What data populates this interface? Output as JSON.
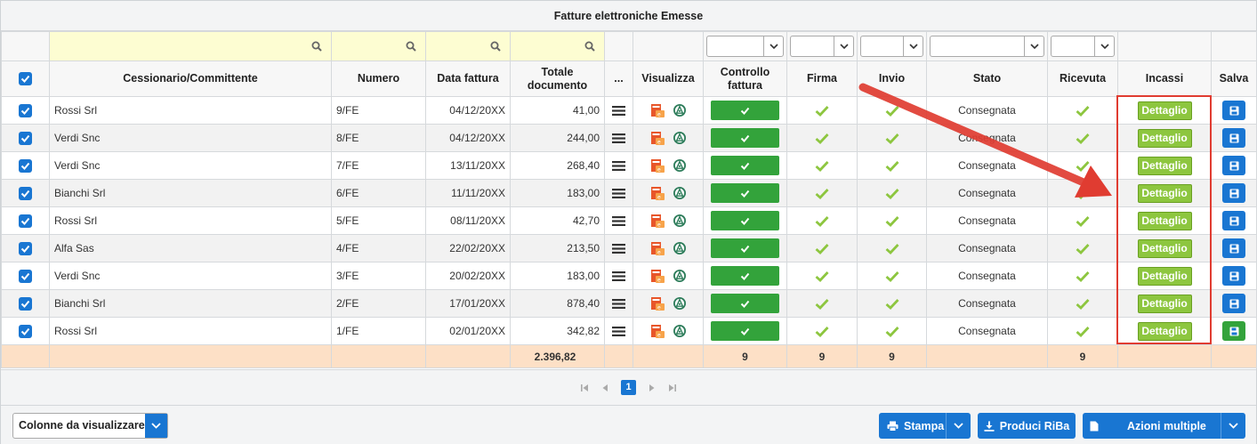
{
  "title": "Fatture elettroniche Emesse",
  "columns": {
    "cessionario": "Cessionario/Committente",
    "numero": "Numero",
    "data": "Data fattura",
    "totale": "Totale documento",
    "more": "...",
    "visualizza": "Visualizza",
    "controllo": "Controllo fattura",
    "firma": "Firma",
    "invio": "Invio",
    "stato": "Stato",
    "ricevuta": "Ricevuta",
    "incassi": "Incassi",
    "salva": "Salva"
  },
  "rows": [
    {
      "cliente": "Rossi Srl",
      "numero": "9/FE",
      "data": "04/12/20XX",
      "totale": "41,00",
      "stato": "Consegnata",
      "dettaglio": "Dettaglio"
    },
    {
      "cliente": "Verdi Snc",
      "numero": "8/FE",
      "data": "04/12/20XX",
      "totale": "244,00",
      "stato": "Consegnata",
      "dettaglio": "Dettaglio"
    },
    {
      "cliente": "Verdi Snc",
      "numero": "7/FE",
      "data": "13/11/20XX",
      "totale": "268,40",
      "stato": "Consegnata",
      "dettaglio": "Dettaglio"
    },
    {
      "cliente": "Bianchi Srl",
      "numero": "6/FE",
      "data": "11/11/20XX",
      "totale": "183,00",
      "stato": "Consegnata",
      "dettaglio": "Dettaglio"
    },
    {
      "cliente": "Rossi Srl",
      "numero": "5/FE",
      "data": "08/11/20XX",
      "totale": "42,70",
      "stato": "Consegnata",
      "dettaglio": "Dettaglio"
    },
    {
      "cliente": "Alfa Sas",
      "numero": "4/FE",
      "data": "22/02/20XX",
      "totale": "213,50",
      "stato": "Consegnata",
      "dettaglio": "Dettaglio"
    },
    {
      "cliente": "Verdi Snc",
      "numero": "3/FE",
      "data": "20/02/20XX",
      "totale": "183,00",
      "stato": "Consegnata",
      "dettaglio": "Dettaglio"
    },
    {
      "cliente": "Bianchi Srl",
      "numero": "2/FE",
      "data": "17/01/20XX",
      "totale": "878,40",
      "stato": "Consegnata",
      "dettaglio": "Dettaglio"
    },
    {
      "cliente": "Rossi Srl",
      "numero": "1/FE",
      "data": "02/01/20XX",
      "totale": "342,82",
      "stato": "Consegnata",
      "dettaglio": "Dettaglio"
    }
  ],
  "footer": {
    "totale": "2.396,82",
    "controllo": "9",
    "firma": "9",
    "invio": "9",
    "ricevuta": "9"
  },
  "pager": {
    "page": "1"
  },
  "buttons": {
    "colonne": "Colonne da visualizzare",
    "stampa": "Stampa",
    "riba": "Produci RiBa",
    "azioni": "Azioni multiple"
  },
  "colors": {
    "accent": "#1976d2",
    "success": "#33a33b",
    "detail": "#8dc63f",
    "footer": "#fde0c6",
    "filter": "#fdfdd2",
    "highlight": "#e03c31"
  },
  "icons": [
    "search-icon",
    "chevron-down-icon",
    "checkbox-icon",
    "menu-icon",
    "pdf-icon",
    "xml-viewer-icon",
    "check-icon",
    "save-icon",
    "print-icon",
    "download-icon",
    "document-icon",
    "first-page-icon",
    "prev-page-icon",
    "next-page-icon",
    "last-page-icon"
  ]
}
